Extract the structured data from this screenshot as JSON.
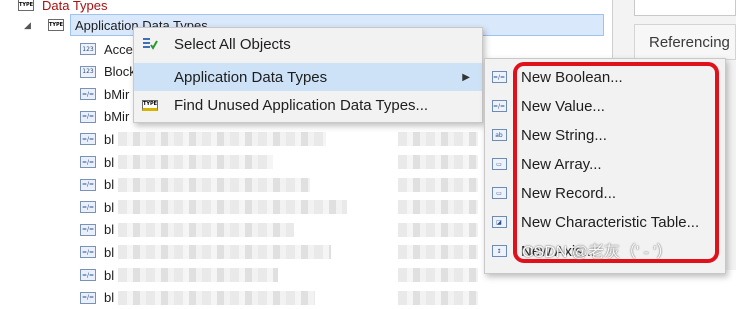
{
  "tree": {
    "root_label": "Data Types",
    "child_label": "Application Data Types",
    "items": [
      {
        "label": "Acce"
      },
      {
        "label": "Block"
      },
      {
        "label": "bMir"
      },
      {
        "label": "bMir"
      },
      {
        "label": "bl"
      },
      {
        "label": "bl"
      },
      {
        "label": "bl"
      },
      {
        "label": "bl"
      },
      {
        "label": "bl"
      },
      {
        "label": "bl"
      },
      {
        "label": "bl"
      },
      {
        "label": "bl"
      }
    ]
  },
  "right_pane": {
    "tab_label": "Referencing"
  },
  "context_menu": {
    "items": [
      {
        "label": "Select All Objects",
        "icon": "select-all-icon"
      },
      {
        "label": "Application Data Types",
        "icon": "none",
        "has_submenu": true
      },
      {
        "label": "Find Unused Application Data Types...",
        "icon": "type-icon"
      }
    ]
  },
  "submenu": {
    "items": [
      {
        "label": "New Boolean...",
        "icon": "boolean-type-icon"
      },
      {
        "label": "New Value...",
        "icon": "value-type-icon"
      },
      {
        "label": "New String...",
        "icon": "string-type-icon"
      },
      {
        "label": "New Array...",
        "icon": "array-type-icon"
      },
      {
        "label": "New Record...",
        "icon": "record-type-icon"
      },
      {
        "label": "New Characteristic Table...",
        "icon": "characteristic-table-icon"
      },
      {
        "label": "New Axis...",
        "icon": "axis-type-icon"
      }
    ]
  },
  "watermark": "CSDN @老灰（' - '）",
  "colors": {
    "highlight": "#cde2f6",
    "annotation_frame": "#e0111b",
    "tree_selection": "#d9e8fb"
  }
}
